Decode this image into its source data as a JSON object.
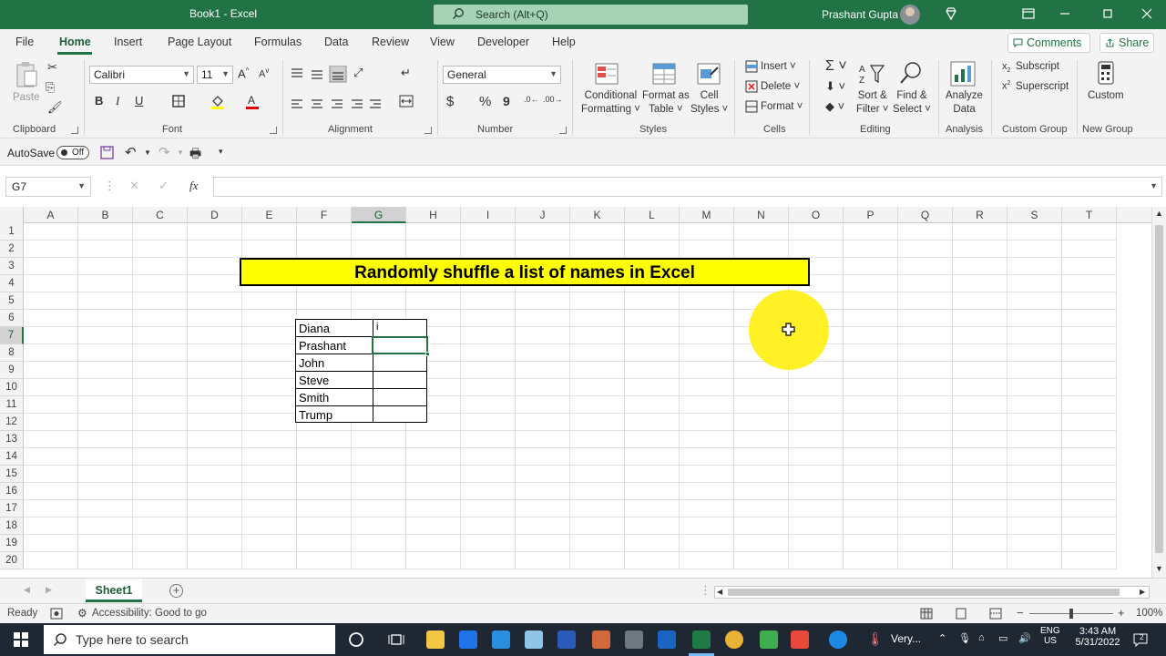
{
  "window": {
    "title": "Book1  -  Excel",
    "search_placeholder": "Search (Alt+Q)",
    "user": "Prashant Gupta"
  },
  "menu": {
    "items": [
      "File",
      "Home",
      "Insert",
      "Page Layout",
      "Formulas",
      "Data",
      "Review",
      "View",
      "Developer",
      "Help"
    ],
    "comments": "Comments",
    "share": "Share"
  },
  "ribbon": {
    "font_name": "Calibri",
    "font_size": "11",
    "number_format": "General",
    "groups": {
      "clipboard": "Clipboard",
      "font": "Font",
      "alignment": "Alignment",
      "number": "Number",
      "styles": "Styles",
      "cells": "Cells",
      "editing": "Editing",
      "analysis": "Analysis",
      "custom_group": "Custom Group",
      "new_group": "New Group"
    },
    "paste": "Paste",
    "cond_format": [
      "Conditional",
      "Formatting"
    ],
    "format_table": [
      "Format as",
      "Table"
    ],
    "cell_styles": [
      "Cell",
      "Styles"
    ],
    "insert": "Insert",
    "delete": "Delete",
    "format": "Format",
    "sort_filter": [
      "Sort &",
      "Filter"
    ],
    "find_select": [
      "Find &",
      "Select"
    ],
    "analyze": [
      "Analyze",
      "Data"
    ],
    "subscript": "Subscript",
    "superscript": "Superscript",
    "custom": "Custom"
  },
  "qat": {
    "autosave": "AutoSave",
    "toggle": "Off"
  },
  "formula_bar": {
    "name_box": "G7",
    "fx": "fx",
    "content": ""
  },
  "sheet": {
    "columns": [
      "A",
      "B",
      "C",
      "D",
      "E",
      "F",
      "G",
      "H",
      "I",
      "J",
      "K",
      "L",
      "M",
      "N",
      "O",
      "P",
      "Q",
      "R",
      "S",
      "T"
    ],
    "selected_column": "G",
    "selected_row": "7",
    "rows": [
      "1",
      "2",
      "3",
      "4",
      "5",
      "6",
      "7",
      "8",
      "9",
      "10",
      "11",
      "12",
      "13",
      "14",
      "15",
      "16",
      "17",
      "18",
      "19",
      "20"
    ],
    "title": "Randomly shuffle a list of names in Excel",
    "names": [
      "Diana",
      "Prashant",
      "John",
      "Steve",
      "Smith",
      "Trump"
    ],
    "g6_value": "i"
  },
  "tabs": {
    "sheet": "Sheet1"
  },
  "status": {
    "ready": "Ready",
    "accessibility": "Accessibility: Good to go",
    "zoom": "100%"
  },
  "taskbar": {
    "search": "Type here to search",
    "weather": "Very...",
    "lang1": "ENG",
    "lang2": "US",
    "time": "3:43 AM",
    "date": "5/31/2022",
    "notifications": "2"
  },
  "colors": {
    "excel_green": "#217346",
    "title_fill": "#ffff00"
  }
}
